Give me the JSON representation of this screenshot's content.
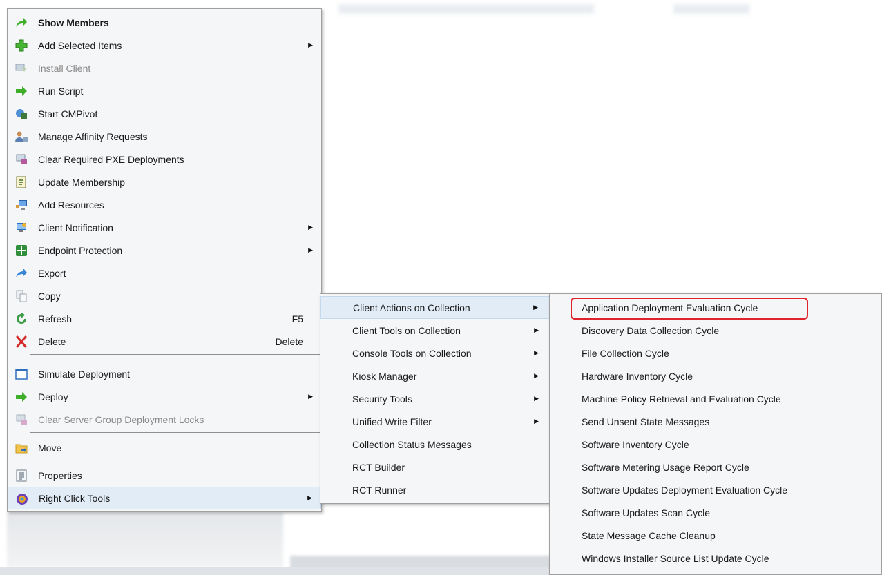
{
  "main_menu": {
    "items": [
      {
        "label": "Show Members",
        "shortcut": "",
        "submenu": false,
        "icon": "green-arrow-icon"
      },
      {
        "label": "Add Selected Items",
        "shortcut": "",
        "submenu": true,
        "icon": "green-plus-icon"
      },
      {
        "label": "Install Client",
        "shortcut": "",
        "submenu": false,
        "icon": "install-client-icon",
        "disabled": true
      },
      {
        "label": "Run Script",
        "shortcut": "",
        "submenu": false,
        "icon": "green-arrow-right-icon"
      },
      {
        "label": "Start CMPivot",
        "shortcut": "",
        "submenu": false,
        "icon": "cmpivot-icon"
      },
      {
        "label": "Manage Affinity Requests",
        "shortcut": "",
        "submenu": false,
        "icon": "users-icon"
      },
      {
        "label": "Clear Required PXE Deployments",
        "shortcut": "",
        "submenu": false,
        "icon": "pxe-icon"
      },
      {
        "label": "Update Membership",
        "shortcut": "",
        "submenu": false,
        "icon": "update-membership-icon"
      },
      {
        "label": "Add Resources",
        "shortcut": "",
        "submenu": false,
        "icon": "add-resources-icon"
      },
      {
        "label": "Client Notification",
        "shortcut": "",
        "submenu": true,
        "icon": "client-notification-icon"
      },
      {
        "label": "Endpoint Protection",
        "shortcut": "",
        "submenu": true,
        "icon": "endpoint-protection-icon"
      },
      {
        "label": "Export",
        "shortcut": "",
        "submenu": false,
        "icon": "blue-arrow-icon"
      },
      {
        "label": "Copy",
        "shortcut": "",
        "submenu": false,
        "icon": "copy-icon"
      },
      {
        "label": "Refresh",
        "shortcut": "F5",
        "submenu": false,
        "icon": "refresh-icon"
      },
      {
        "label": "Delete",
        "shortcut": "Delete",
        "submenu": false,
        "icon": "delete-icon"
      },
      {
        "label": "Simulate Deployment",
        "shortcut": "",
        "submenu": false,
        "icon": "simulate-deployment-icon"
      },
      {
        "label": "Deploy",
        "shortcut": "",
        "submenu": true,
        "icon": "deploy-icon"
      },
      {
        "label": "Clear Server Group Deployment Locks",
        "shortcut": "",
        "submenu": false,
        "icon": "locks-icon",
        "disabled": true
      },
      {
        "label": "Move",
        "shortcut": "",
        "submenu": false,
        "icon": "folder-move-icon"
      },
      {
        "label": "Properties",
        "shortcut": "",
        "submenu": false,
        "icon": "properties-icon"
      },
      {
        "label": "Right Click Tools",
        "shortcut": "",
        "submenu": true,
        "icon": "right-click-tools-icon"
      }
    ]
  },
  "sub_menu": {
    "items": [
      {
        "label": "Client Actions on Collection",
        "submenu": true
      },
      {
        "label": "Client Tools on Collection",
        "submenu": true
      },
      {
        "label": "Console Tools on Collection",
        "submenu": true
      },
      {
        "label": "Kiosk Manager",
        "submenu": true
      },
      {
        "label": "Security Tools",
        "submenu": true
      },
      {
        "label": "Unified Write Filter",
        "submenu": true
      },
      {
        "label": "Collection Status Messages",
        "submenu": false
      },
      {
        "label": "RCT Builder",
        "submenu": false
      },
      {
        "label": "RCT Runner",
        "submenu": false
      }
    ]
  },
  "sub2_menu": {
    "items": [
      {
        "label": "Application Deployment Evaluation Cycle"
      },
      {
        "label": "Discovery Data Collection Cycle"
      },
      {
        "label": "File Collection Cycle"
      },
      {
        "label": "Hardware Inventory Cycle"
      },
      {
        "label": "Machine Policy Retrieval and Evaluation Cycle"
      },
      {
        "label": "Send Unsent State Messages"
      },
      {
        "label": "Software Inventory Cycle"
      },
      {
        "label": "Software Metering Usage Report Cycle"
      },
      {
        "label": "Software Updates Deployment Evaluation Cycle"
      },
      {
        "label": "Software Updates Scan Cycle"
      },
      {
        "label": "State Message Cache Cleanup"
      },
      {
        "label": "Windows Installer Source List Update Cycle"
      }
    ]
  },
  "colors": {
    "highlight": "#e2ecf7",
    "callout": "#e0242b"
  }
}
